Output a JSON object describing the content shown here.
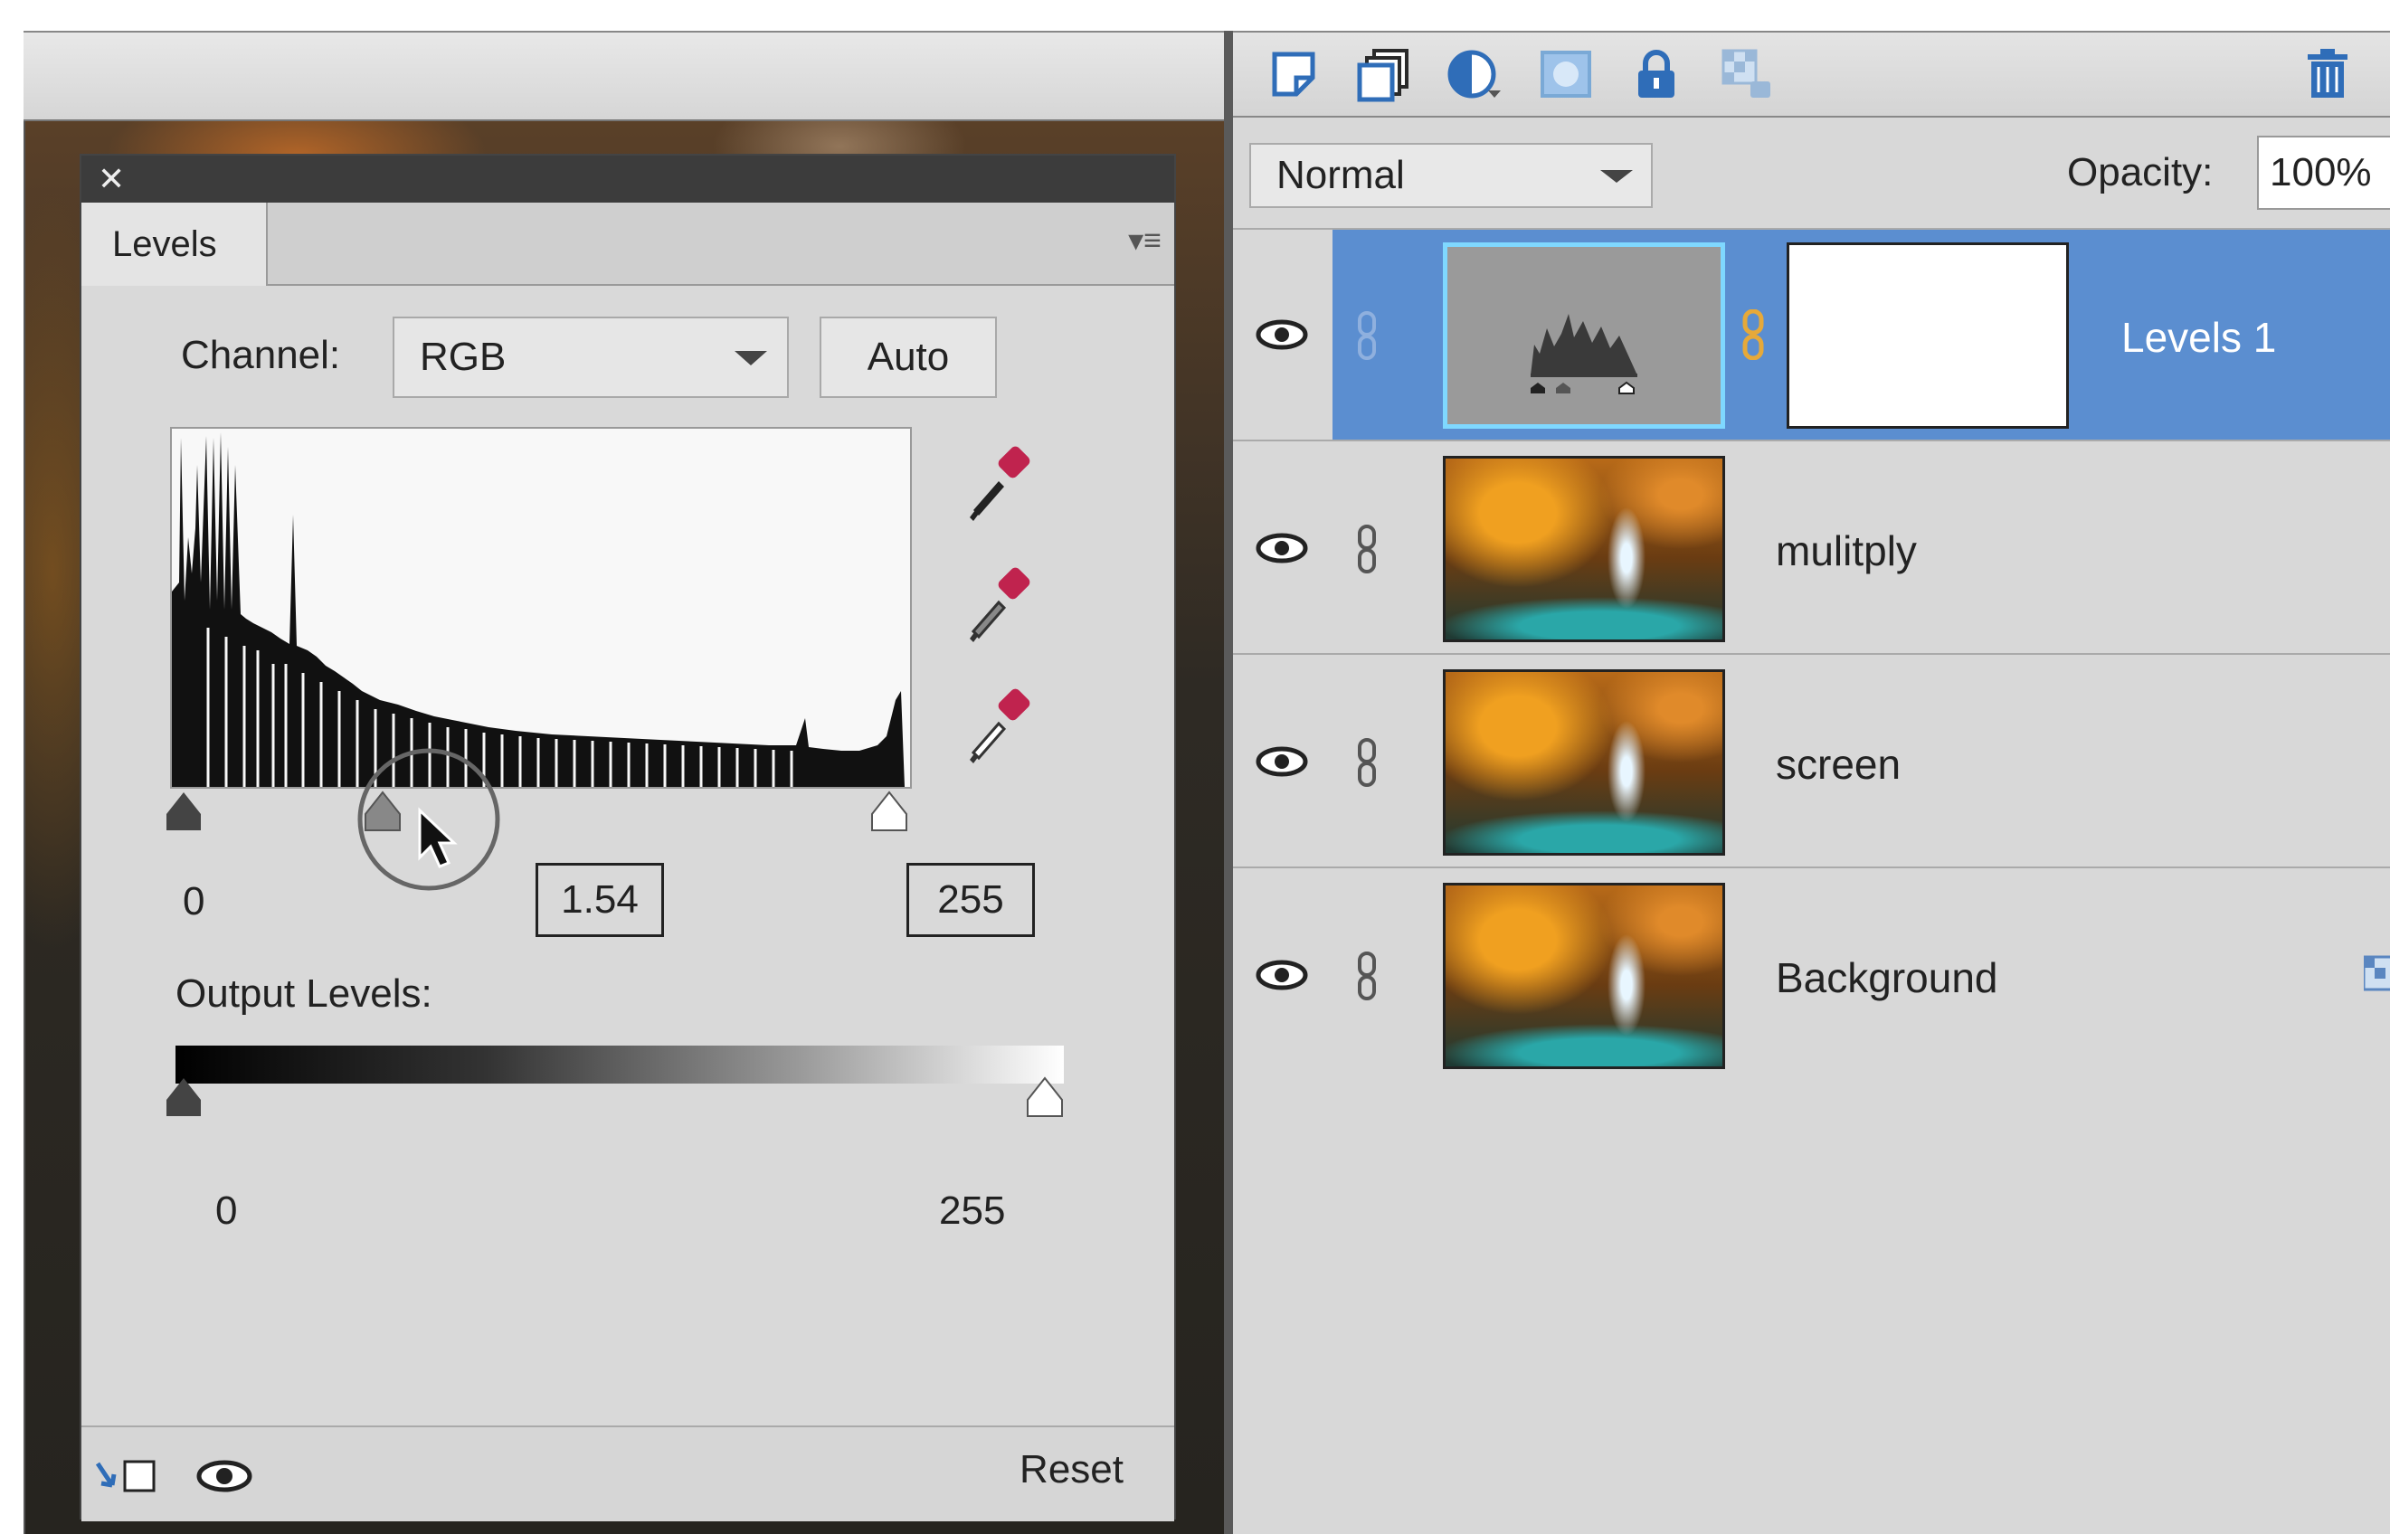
{
  "levels_panel": {
    "tab_label": "Levels",
    "channel_label": "Channel:",
    "channel_value": "RGB",
    "auto_label": "Auto",
    "input_black": "0",
    "input_gamma": "1.54",
    "input_white": "255",
    "output_label": "Output Levels:",
    "output_black": "0",
    "output_white": "255",
    "reset_label": "Reset"
  },
  "layers_panel": {
    "blend_mode": "Normal",
    "opacity_label": "Opacity:",
    "opacity_value": "100%",
    "layers": [
      {
        "name": "Levels 1",
        "selected": true,
        "type": "adjustment"
      },
      {
        "name": "mulitply",
        "selected": false,
        "type": "photo"
      },
      {
        "name": "screen",
        "selected": false,
        "type": "photo"
      },
      {
        "name": "Background",
        "selected": false,
        "type": "photo"
      }
    ]
  },
  "colors": {
    "selected_row": "#5b8ed0",
    "panel_bg": "#d9d9d9",
    "toolbar_icon": "#2f6db8"
  },
  "icons": [
    "close-icon",
    "panel-menu-icon",
    "black-eyedropper-icon",
    "gray-eyedropper-icon",
    "white-eyedropper-icon",
    "clip-to-layer-icon",
    "visibility-eye-icon",
    "new-layer-icon",
    "duplicate-layer-icon",
    "adjustment-layer-icon",
    "layer-mask-icon",
    "lock-icon",
    "lock-transparent-icon",
    "trash-icon",
    "layer-eye-icon",
    "layer-link-icon"
  ]
}
